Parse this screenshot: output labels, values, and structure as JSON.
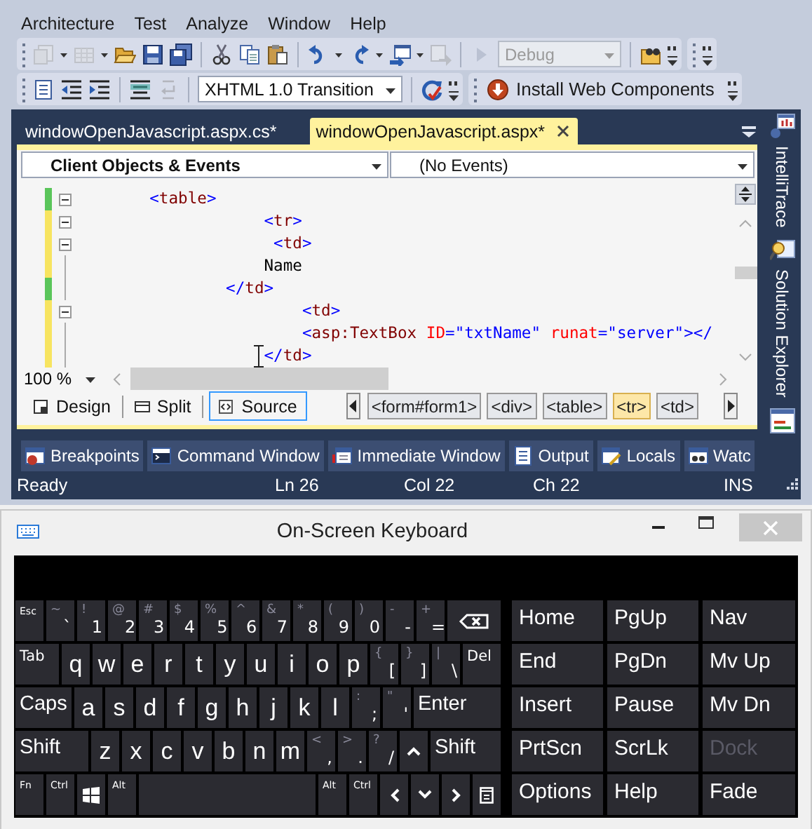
{
  "menu": [
    "Architecture",
    "Test",
    "Analyze",
    "Window",
    "Help"
  ],
  "toolbar_1": {
    "config_combo": {
      "value": "Debug",
      "disabled": true
    }
  },
  "toolbar_2": {
    "doctype_combo": {
      "value": "XHTML 1.0 Transition",
      "disabled": false
    },
    "install_button": {
      "label": "Install Web Components"
    }
  },
  "document_tabs": [
    {
      "label": "windowOpenJavascript.aspx.cs*",
      "selected": false
    },
    {
      "label": "windowOpenJavascript.aspx*",
      "selected": true
    }
  ],
  "object_combo": {
    "value": "Client Objects & Events"
  },
  "event_combo": {
    "value": "(No Events)"
  },
  "code_lines": [
    {
      "text": "       <table>",
      "saved": true,
      "collapsible": true
    },
    {
      "text": "                   <tr>",
      "saved": false,
      "collapsible": true
    },
    {
      "text": "                    <td>",
      "saved": false,
      "collapsible": true
    },
    {
      "text": "                   Name",
      "saved": false,
      "collapsible": false
    },
    {
      "text": "               </td>",
      "saved": true,
      "collapsible": false
    },
    {
      "text": "                       <td>",
      "saved": false,
      "collapsible": true
    },
    {
      "text": "                       <asp:TextBox ID=\"txtName\" runat=\"server\"></",
      "saved": false,
      "collapsible": false
    },
    {
      "text": "                   </td>",
      "saved": false,
      "collapsible": false
    }
  ],
  "zoom_combo": {
    "value": "100 %"
  },
  "view_buttons": [
    {
      "label": "Design",
      "selected": false
    },
    {
      "label": "Split",
      "selected": false
    },
    {
      "label": "Source",
      "selected": true
    }
  ],
  "breadcrumbs": [
    {
      "label": "<form#form1>",
      "selected": false
    },
    {
      "label": "<div>",
      "selected": false
    },
    {
      "label": "<table>",
      "selected": false
    },
    {
      "label": "<tr>",
      "selected": true
    },
    {
      "label": "<td>",
      "selected": false
    }
  ],
  "side_tabs": [
    {
      "label": "IntelliTrace"
    },
    {
      "label": "Solution Explorer"
    }
  ],
  "tool_tabs": [
    {
      "label": "Breakpoints"
    },
    {
      "label": "Command Window"
    },
    {
      "label": "Immediate Window"
    },
    {
      "label": "Output"
    },
    {
      "label": "Locals"
    },
    {
      "label": "Watc"
    }
  ],
  "status_bar": [
    "Ready",
    "Ln 26",
    "Col 22",
    "Ch 22",
    "INS"
  ],
  "keyboard_window": {
    "title": "On-Screen Keyboard"
  },
  "keyboard_rows": [
    [
      {
        "kind": "small",
        "label": "Esc"
      },
      {
        "kind": "dual",
        "shift": "~",
        "label": "`"
      },
      {
        "kind": "dual",
        "shift": "!",
        "label": "1"
      },
      {
        "kind": "dual",
        "shift": "@",
        "label": "2"
      },
      {
        "kind": "dual",
        "shift": "#",
        "label": "3"
      },
      {
        "kind": "dual",
        "shift": "$",
        "label": "4"
      },
      {
        "kind": "dual",
        "shift": "%",
        "label": "5"
      },
      {
        "kind": "dual",
        "shift": "^",
        "label": "6"
      },
      {
        "kind": "dual",
        "shift": "&",
        "label": "7"
      },
      {
        "kind": "dual",
        "shift": "*",
        "label": "8"
      },
      {
        "kind": "dual",
        "shift": "(",
        "label": "9"
      },
      {
        "kind": "dual",
        "shift": ")",
        "label": "0"
      },
      {
        "kind": "dual",
        "shift": "-",
        "label": "-"
      },
      {
        "kind": "dual",
        "shift": "+",
        "label": "="
      },
      {
        "kind": "backspace"
      }
    ],
    [
      {
        "kind": "word",
        "label": "Tab"
      },
      {
        "kind": "letter",
        "label": "q"
      },
      {
        "kind": "letter",
        "label": "w"
      },
      {
        "kind": "letter",
        "label": "e"
      },
      {
        "kind": "letter",
        "label": "r"
      },
      {
        "kind": "letter",
        "label": "t"
      },
      {
        "kind": "letter",
        "label": "y"
      },
      {
        "kind": "letter",
        "label": "u"
      },
      {
        "kind": "letter",
        "label": "i"
      },
      {
        "kind": "letter",
        "label": "o"
      },
      {
        "kind": "letter",
        "label": "p"
      },
      {
        "kind": "dual",
        "shift": "{",
        "label": "["
      },
      {
        "kind": "dual",
        "shift": "}",
        "label": "]"
      },
      {
        "kind": "dual",
        "shift": "|",
        "label": "\\"
      },
      {
        "kind": "word",
        "label": "Del"
      }
    ],
    [
      {
        "kind": "big",
        "label": "Caps"
      },
      {
        "kind": "letter",
        "label": "a"
      },
      {
        "kind": "letter",
        "label": "s"
      },
      {
        "kind": "letter",
        "label": "d"
      },
      {
        "kind": "letter",
        "label": "f"
      },
      {
        "kind": "letter",
        "label": "g"
      },
      {
        "kind": "letter",
        "label": "h"
      },
      {
        "kind": "letter",
        "label": "j"
      },
      {
        "kind": "letter",
        "label": "k"
      },
      {
        "kind": "letter",
        "label": "l"
      },
      {
        "kind": "dual",
        "shift": ":",
        "label": ";"
      },
      {
        "kind": "dual",
        "shift": "\"",
        "label": "'"
      },
      {
        "kind": "big",
        "label": "Enter"
      }
    ],
    [
      {
        "kind": "big",
        "label": "Shift"
      },
      {
        "kind": "letter",
        "label": "z"
      },
      {
        "kind": "letter",
        "label": "x"
      },
      {
        "kind": "letter",
        "label": "c"
      },
      {
        "kind": "letter",
        "label": "v"
      },
      {
        "kind": "letter",
        "label": "b"
      },
      {
        "kind": "letter",
        "label": "n"
      },
      {
        "kind": "letter",
        "label": "m"
      },
      {
        "kind": "dual",
        "shift": "<",
        "label": ","
      },
      {
        "kind": "dual",
        "shift": ">",
        "label": "."
      },
      {
        "kind": "dual",
        "shift": "?",
        "label": "/"
      },
      {
        "kind": "up"
      },
      {
        "kind": "big",
        "label": "Shift"
      }
    ],
    [
      {
        "kind": "small",
        "label": "Fn"
      },
      {
        "kind": "small",
        "label": "Ctrl"
      },
      {
        "kind": "windows"
      },
      {
        "kind": "small",
        "label": "Alt"
      },
      {
        "kind": "space"
      },
      {
        "kind": "small",
        "label": "Alt"
      },
      {
        "kind": "small",
        "label": "Ctrl"
      },
      {
        "kind": "left"
      },
      {
        "kind": "down"
      },
      {
        "kind": "right"
      },
      {
        "kind": "menu"
      }
    ]
  ],
  "nav_keys": [
    {
      "label": "Home",
      "disabled": false
    },
    {
      "label": "PgUp",
      "disabled": false
    },
    {
      "label": "Nav",
      "disabled": false
    },
    {
      "label": "End",
      "disabled": false
    },
    {
      "label": "PgDn",
      "disabled": false
    },
    {
      "label": "Mv Up",
      "disabled": false
    },
    {
      "label": "Insert",
      "disabled": false
    },
    {
      "label": "Pause",
      "disabled": false
    },
    {
      "label": "Mv Dn",
      "disabled": false
    },
    {
      "label": "PrtScn",
      "disabled": false
    },
    {
      "label": "ScrLk",
      "disabled": false
    },
    {
      "label": "Dock",
      "disabled": true
    },
    {
      "label": "Options",
      "disabled": false
    },
    {
      "label": "Help",
      "disabled": false
    },
    {
      "label": "Fade",
      "disabled": false
    }
  ]
}
